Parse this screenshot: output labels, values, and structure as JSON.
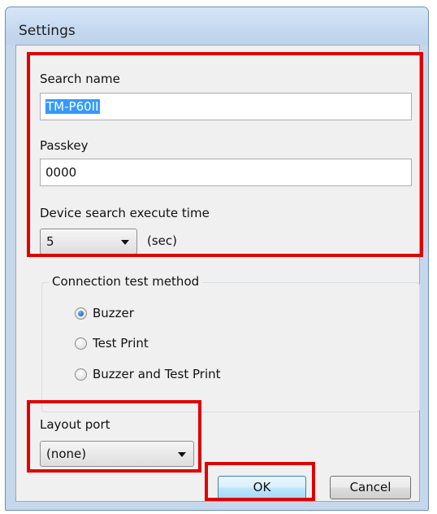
{
  "window": {
    "title": "Settings"
  },
  "search_name": {
    "label": "Search name",
    "value": "TM-P60II"
  },
  "passkey": {
    "label": "Passkey",
    "value": "0000"
  },
  "device_search": {
    "label": "Device search execute time",
    "value": "5",
    "unit": "(sec)"
  },
  "connection_test": {
    "legend": "Connection test method",
    "options": [
      {
        "label": "Buzzer",
        "checked": true
      },
      {
        "label": "Test Print",
        "checked": false
      },
      {
        "label": "Buzzer and Test Print",
        "checked": false
      }
    ]
  },
  "layout_port": {
    "label": "Layout port",
    "value": "(none)"
  },
  "buttons": {
    "ok": "OK",
    "cancel": "Cancel"
  },
  "highlight_color": "#e00000"
}
